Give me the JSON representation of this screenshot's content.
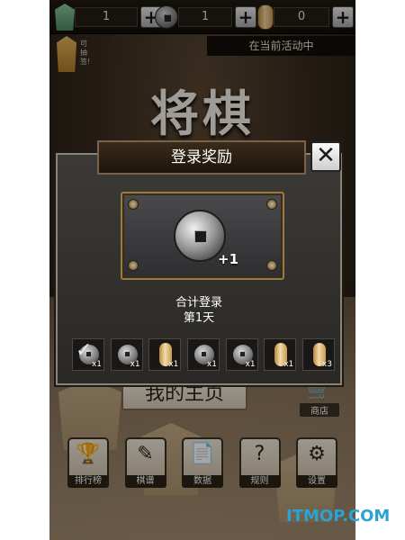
{
  "topbar": {
    "piece_count": "1",
    "coin_count": "1",
    "gold_count": "0",
    "plus": "+"
  },
  "lottery": {
    "line1": "可",
    "line2": "抽签!"
  },
  "event_text": "在当前活动中",
  "title": "将棋",
  "modal": {
    "title": "登录奖励",
    "close_label": "✕",
    "reward_qty": "+1",
    "login_line1": "合计登录",
    "login_line2": "第1天"
  },
  "days": [
    {
      "type": "coin",
      "count": "x1",
      "claimed": true
    },
    {
      "type": "coin",
      "count": "x1",
      "claimed": false
    },
    {
      "type": "gold",
      "count": "x1",
      "claimed": false
    },
    {
      "type": "coin",
      "count": "x1",
      "claimed": false
    },
    {
      "type": "coin",
      "count": "x1",
      "claimed": false
    },
    {
      "type": "gold",
      "count": "x1",
      "claimed": false
    },
    {
      "type": "gold",
      "count": "x3",
      "claimed": false
    }
  ],
  "main_button": "我的主页",
  "shop_label": "商店",
  "nav": [
    {
      "label": "排行榜",
      "icon": "trophy-icon",
      "glyph": "🏆"
    },
    {
      "label": "棋谱",
      "icon": "pencil-icon",
      "glyph": "✎"
    },
    {
      "label": "数据",
      "icon": "document-icon",
      "glyph": "📄"
    },
    {
      "label": "规则",
      "icon": "question-icon",
      "glyph": "?"
    },
    {
      "label": "设置",
      "icon": "gear-icon",
      "glyph": "⚙"
    }
  ],
  "watermark": "ITMOP.COM",
  "colors": {
    "accent_gold": "#9a7a45",
    "watermark": "#2aa3d4"
  }
}
